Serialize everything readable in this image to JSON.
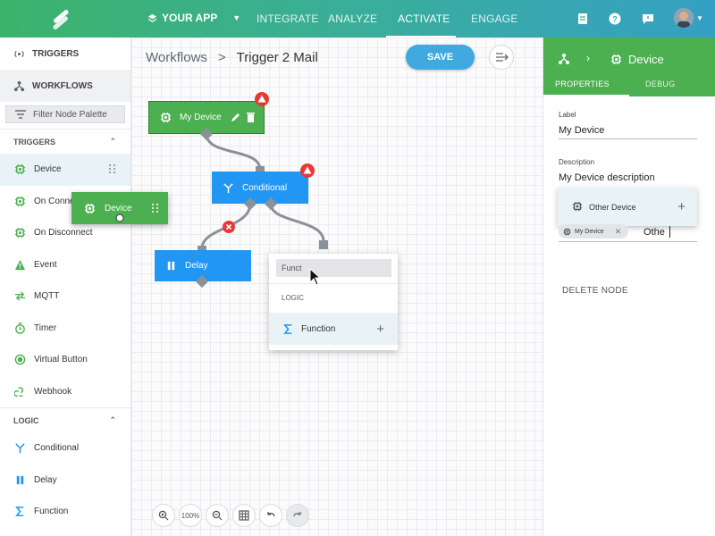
{
  "topbar": {
    "app_name": "YOUR APP",
    "nav": [
      {
        "label": "INTEGRATE",
        "active": false
      },
      {
        "label": "ANALYZE",
        "active": false
      },
      {
        "label": "ACTIVATE",
        "active": true
      },
      {
        "label": "ENGAGE",
        "active": false
      }
    ],
    "icons": [
      "docs-icon",
      "help-icon",
      "chat-icon",
      "avatar"
    ]
  },
  "sidebar": {
    "tabs": [
      {
        "label": "TRIGGERS",
        "icon": "broadcast-icon"
      },
      {
        "label": "WORKFLOWS",
        "icon": "workflow-icon"
      }
    ],
    "filter_placeholder": "Filter Node Palette",
    "sections": [
      {
        "title": "TRIGGERS",
        "items": [
          {
            "label": "Device",
            "icon": "chip-icon"
          },
          {
            "label": "On Connect",
            "icon": "chip-icon"
          },
          {
            "label": "On Disconnect",
            "icon": "chip-icon"
          },
          {
            "label": "Event",
            "icon": "warning-icon"
          },
          {
            "label": "MQTT",
            "icon": "arrows-icon"
          },
          {
            "label": "Timer",
            "icon": "timer-icon"
          },
          {
            "label": "Virtual Button",
            "icon": "radio-icon"
          },
          {
            "label": "Webhook",
            "icon": "webhook-icon"
          }
        ]
      },
      {
        "title": "LOGIC",
        "items": [
          {
            "label": "Conditional",
            "icon": "branch-icon"
          },
          {
            "label": "Delay",
            "icon": "pause-icon"
          },
          {
            "label": "Function",
            "icon": "sigma-icon"
          }
        ]
      }
    ]
  },
  "canvas": {
    "breadcrumb": {
      "root": "Workflows",
      "separator": ">",
      "current": "Trigger 2 Mail"
    },
    "save_label": "SAVE",
    "nodes": {
      "my_device": "My Device",
      "conditional": "Conditional",
      "delay": "Delay"
    },
    "drag_ghost": "Device",
    "popup": {
      "search_value": "Funct",
      "section": "LOGIC",
      "option": "Function"
    },
    "zoom_label": "100%"
  },
  "panel": {
    "title": "Device",
    "tabs": [
      {
        "label": "PROPERTIES",
        "active": true
      },
      {
        "label": "DEBUG",
        "active": false
      }
    ],
    "label_caption": "Label",
    "label_value": "My Device",
    "description_caption": "Description",
    "description_value": "My Device description",
    "dropdown_option": "Other Device",
    "chip_label": "My Device",
    "tag_input": "Othe",
    "delete_label": "DELETE NODE"
  },
  "colors": {
    "green": "#4caf50",
    "blue": "#2196f3",
    "accent_blue": "#3fa9e0",
    "warning_red": "#e53935"
  }
}
